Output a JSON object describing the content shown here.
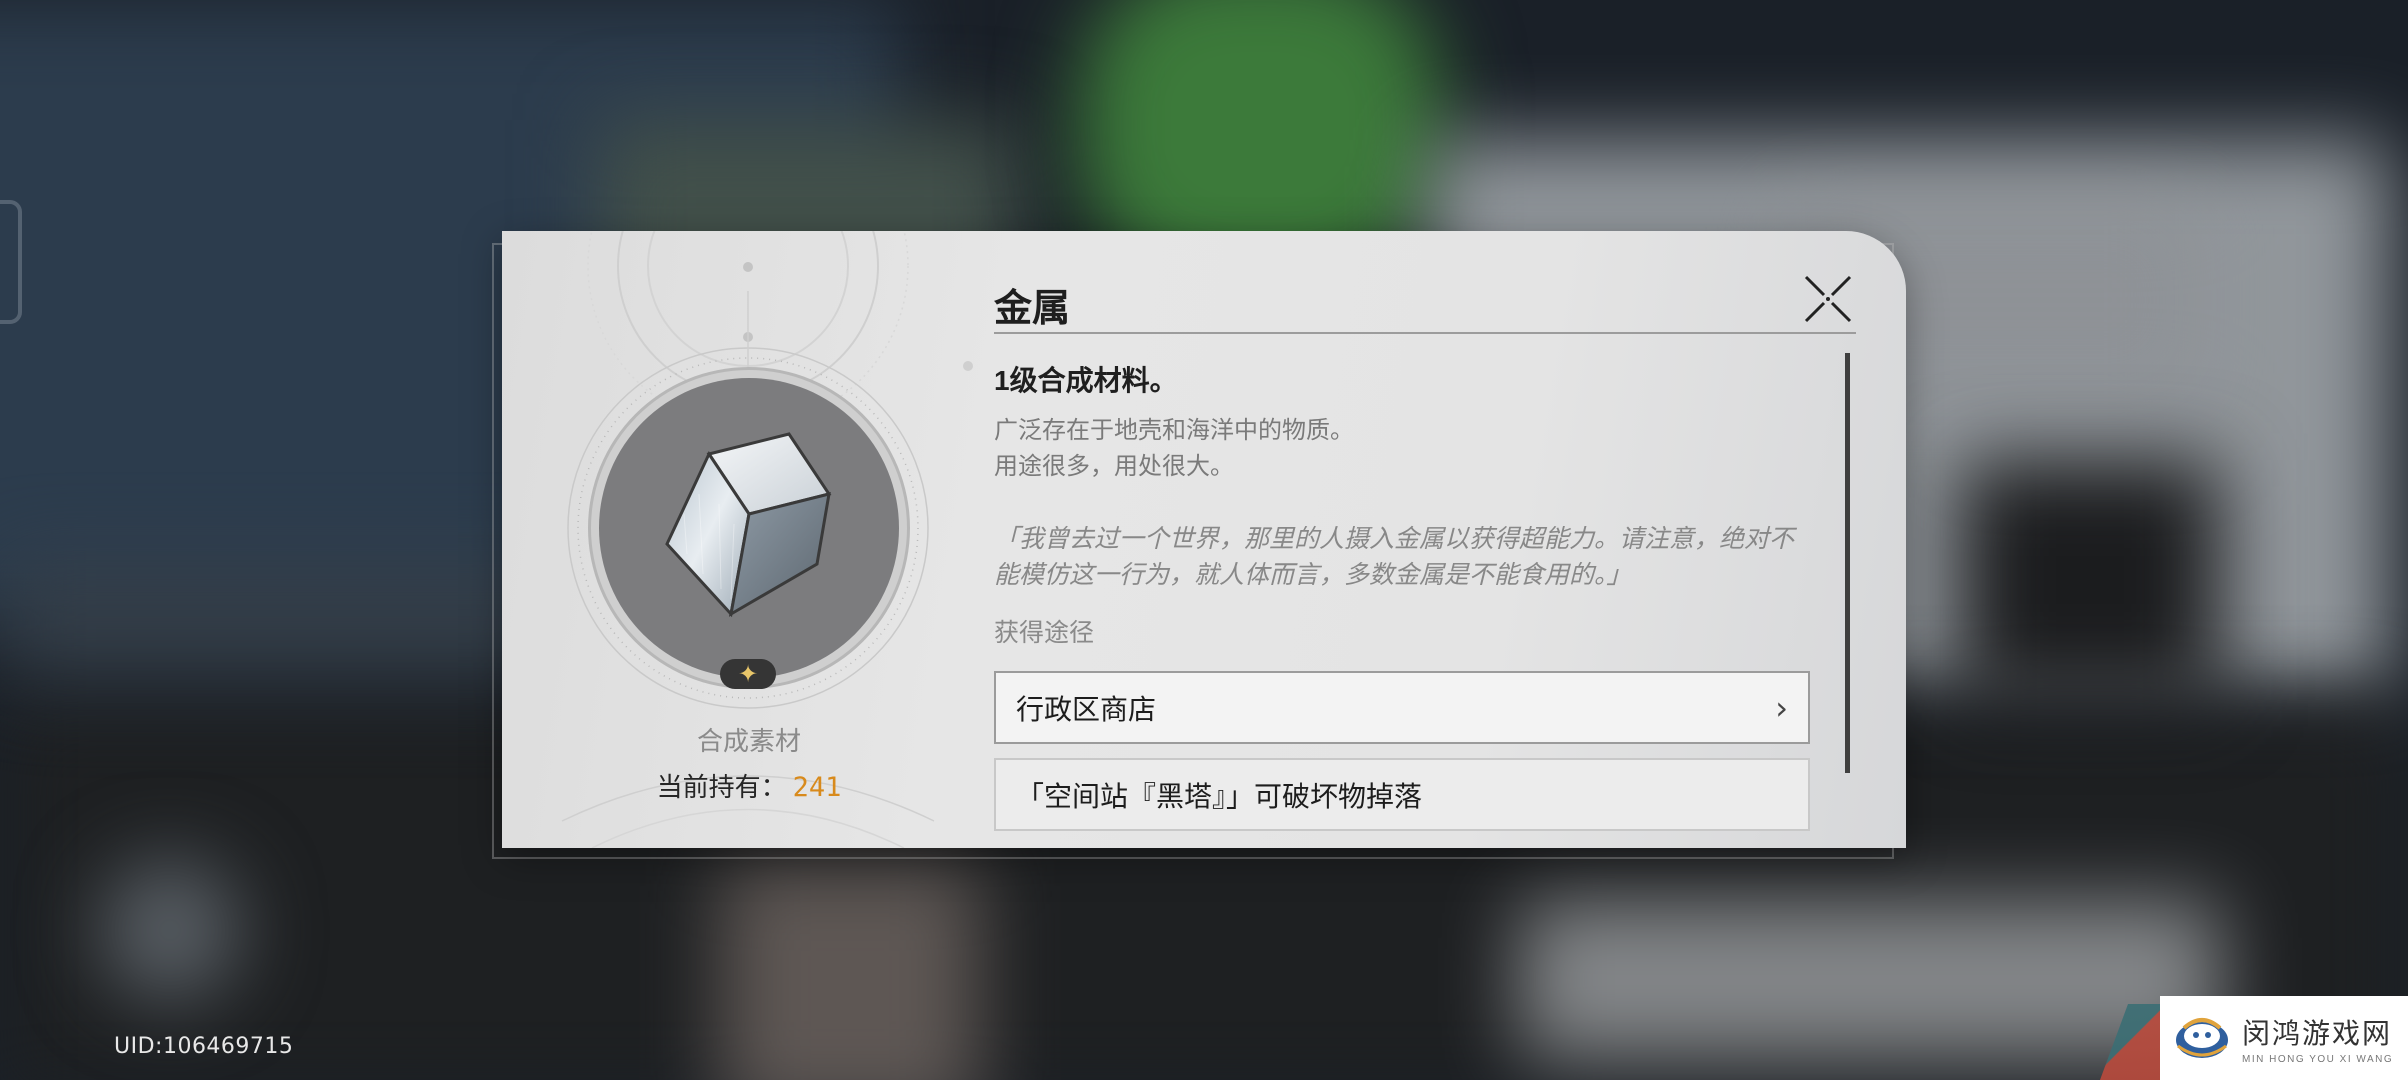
{
  "item": {
    "name": "金属",
    "subtitle": "1级合成材料。",
    "description_lines": [
      "广泛存在于地壳和海洋中的物质。",
      "用途很多，用处很大。"
    ],
    "quote": "「我曾去过一个世界，那里的人摄入金属以获得超能力。请注意，绝对不能模仿这一行为，就人体而言，多数金属是不能食用的。」",
    "type_label": "合成素材",
    "held_label": "当前持有：",
    "held_count": "241",
    "rarity_stars": 1,
    "icon": "metal-cube-icon"
  },
  "obtain": {
    "label": "获得途径",
    "sources": [
      {
        "label": "行政区商店",
        "icon": "chevron-right-icon"
      },
      {
        "label": "「空间站『黑塔』」可破坏物掉落"
      }
    ]
  },
  "close_icon": "close-icon",
  "uid": "UID:106469715",
  "watermark": {
    "title": "闵鸿游戏网",
    "subtitle": "MIN HONG YOU XI WANG"
  },
  "colors": {
    "accent_count": "#d88a1c",
    "rarity_star": "#e8c66a",
    "dialog_bg": "#e4e4e4"
  }
}
